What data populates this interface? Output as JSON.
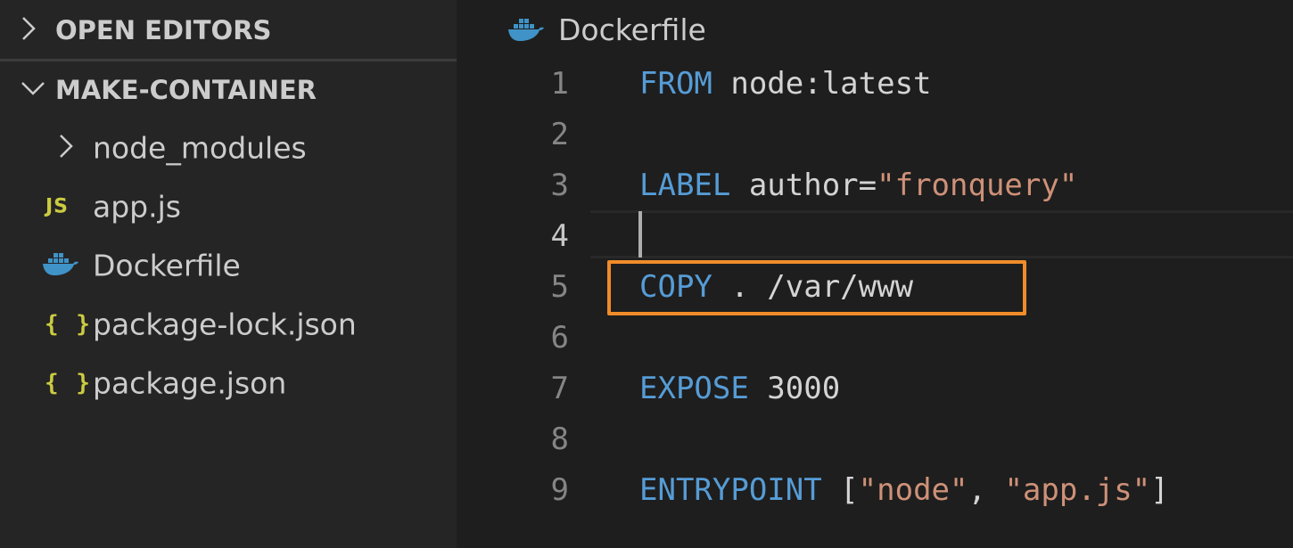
{
  "sidebar": {
    "open_editors": {
      "title": "OPEN EDITORS",
      "expanded": false
    },
    "folder": {
      "title": "MAKE-CONTAINER",
      "expanded": true
    },
    "items": [
      {
        "label": "node_modules",
        "type": "folder",
        "icon": "chevron-right-icon"
      },
      {
        "label": "app.js",
        "type": "file",
        "icon": "js-icon",
        "icon_text": "JS"
      },
      {
        "label": "Dockerfile",
        "type": "file",
        "icon": "docker-icon"
      },
      {
        "label": "package-lock.json",
        "type": "file",
        "icon": "json-icon",
        "icon_text": "{ }"
      },
      {
        "label": "package.json",
        "type": "file",
        "icon": "json-icon",
        "icon_text": "{ }"
      }
    ]
  },
  "editor": {
    "tab": {
      "title": "Dockerfile",
      "icon": "docker-icon"
    },
    "active_line": 4,
    "highlighted_line": 5,
    "lines": [
      {
        "number": "1",
        "tokens": [
          {
            "text": "FROM",
            "type": "keyword"
          },
          {
            "text": " node:latest",
            "type": "plain"
          }
        ]
      },
      {
        "number": "2",
        "tokens": []
      },
      {
        "number": "3",
        "tokens": [
          {
            "text": "LABEL",
            "type": "keyword"
          },
          {
            "text": " author=",
            "type": "plain"
          },
          {
            "text": "\"fronquery\"",
            "type": "string"
          }
        ]
      },
      {
        "number": "4",
        "tokens": []
      },
      {
        "number": "5",
        "tokens": [
          {
            "text": "COPY",
            "type": "keyword"
          },
          {
            "text": " . /var/www",
            "type": "plain"
          }
        ]
      },
      {
        "number": "6",
        "tokens": []
      },
      {
        "number": "7",
        "tokens": [
          {
            "text": "EXPOSE",
            "type": "keyword"
          },
          {
            "text": " 3000",
            "type": "plain"
          }
        ]
      },
      {
        "number": "8",
        "tokens": []
      },
      {
        "number": "9",
        "tokens": [
          {
            "text": "ENTRYPOINT",
            "type": "keyword"
          },
          {
            "text": " [",
            "type": "plain"
          },
          {
            "text": "\"node\"",
            "type": "string"
          },
          {
            "text": ", ",
            "type": "plain"
          },
          {
            "text": "\"app.js\"",
            "type": "string"
          },
          {
            "text": "]",
            "type": "plain"
          }
        ]
      }
    ]
  },
  "colors": {
    "keyword": "#569cd6",
    "string": "#ce9178",
    "plain": "#d4d4d4",
    "highlight_box": "#f08c2a",
    "docker_blue": "#3f93c7",
    "json_yellow": "#cbcb41"
  }
}
